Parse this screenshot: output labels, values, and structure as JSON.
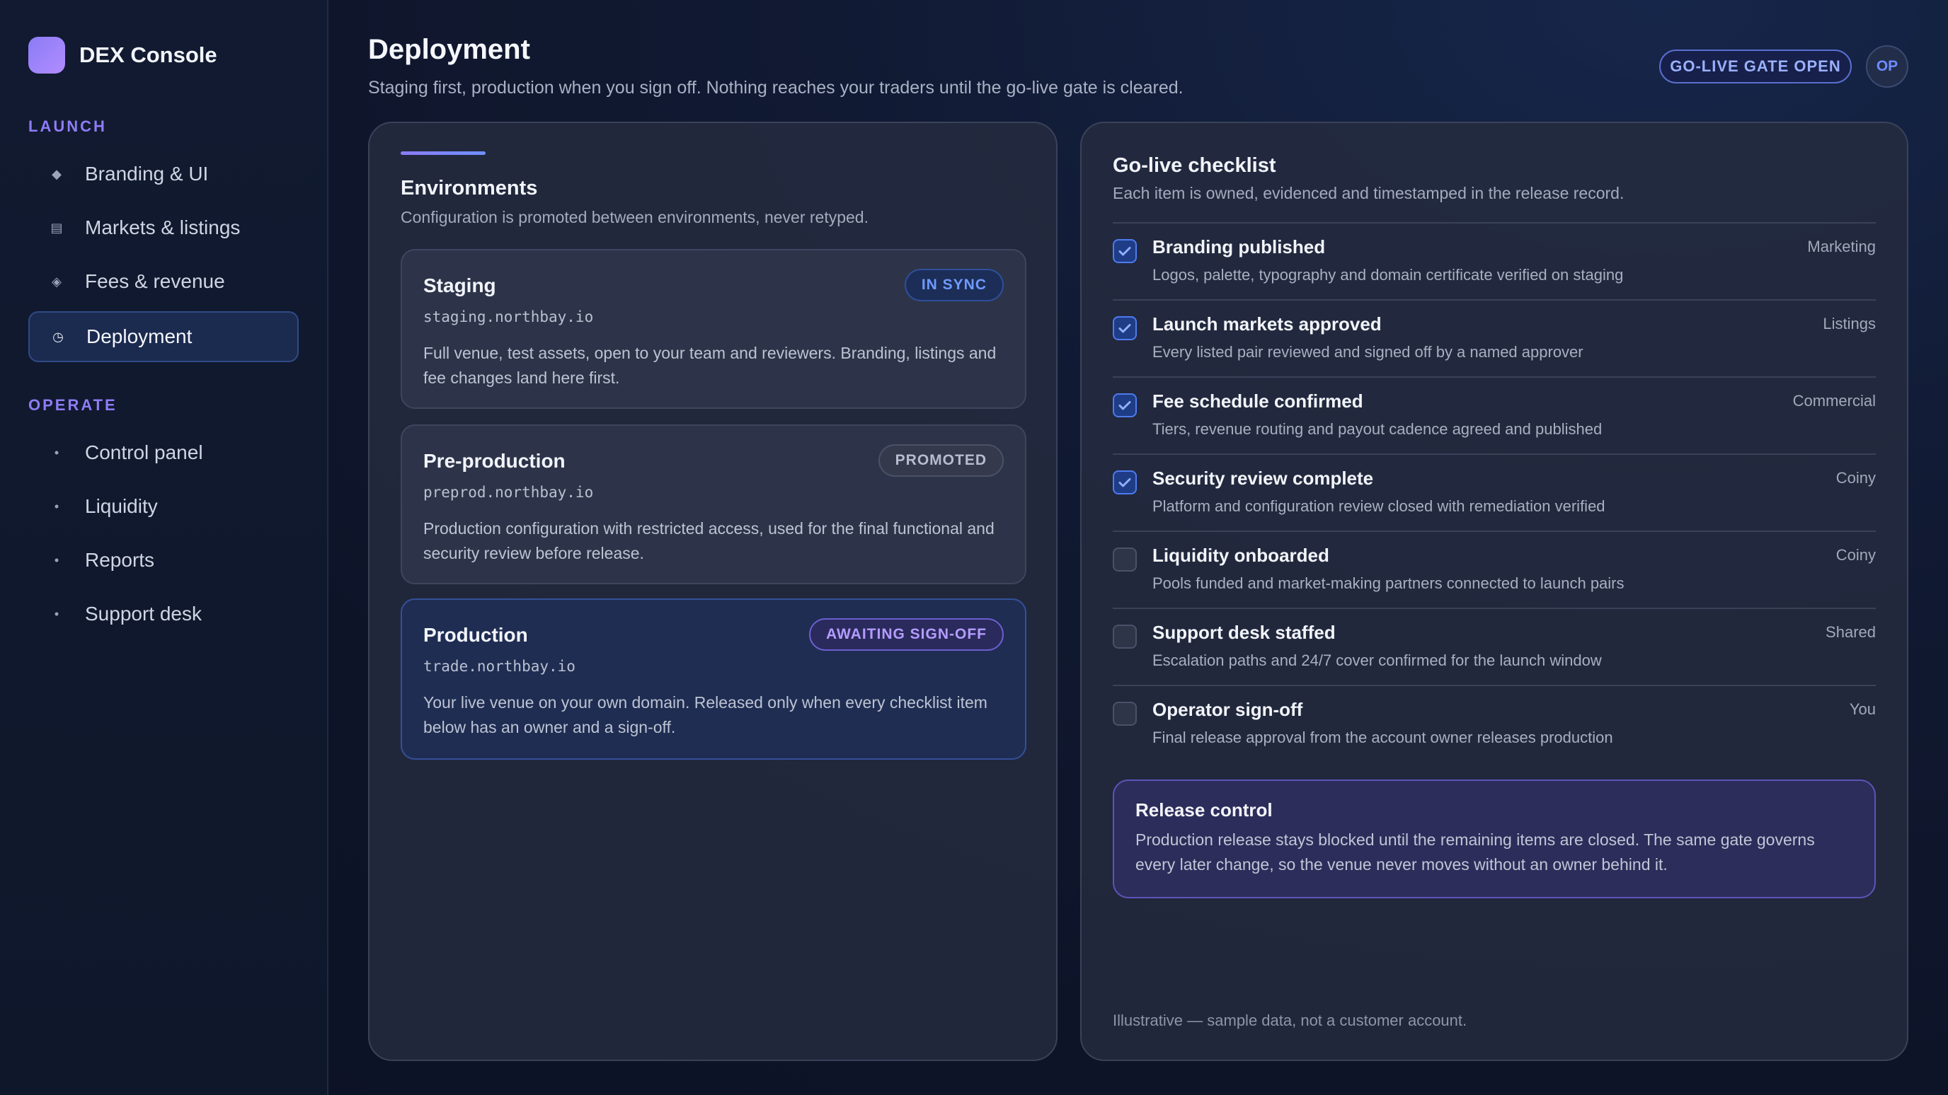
{
  "app": {
    "name": "DEX Console"
  },
  "sidebar": {
    "sections": [
      {
        "label": "LAUNCH",
        "items": [
          {
            "label": "Branding & UI",
            "icon": "diamond-icon"
          },
          {
            "label": "Markets & listings",
            "icon": "list-icon"
          },
          {
            "label": "Fees & revenue",
            "icon": "diamond-outline-icon"
          },
          {
            "label": "Deployment",
            "icon": "clock-icon",
            "active": true
          }
        ]
      },
      {
        "label": "OPERATE",
        "items": [
          {
            "label": "Control panel",
            "icon": "bullet-icon"
          },
          {
            "label": "Liquidity",
            "icon": "bullet-icon"
          },
          {
            "label": "Reports",
            "icon": "bullet-icon"
          },
          {
            "label": "Support desk",
            "icon": "bullet-icon"
          }
        ]
      }
    ]
  },
  "header": {
    "title": "Deployment",
    "subtitle": "Staging first, production when you sign off. Nothing reaches your traders until the go-live gate is cleared.",
    "gate_badge": "GO-LIVE GATE OPEN",
    "avatar": "OP"
  },
  "environments": {
    "title": "Environments",
    "subtitle": "Configuration is promoted between environments, never retyped.",
    "cards": [
      {
        "name": "Staging",
        "host": "staging.northbay.io",
        "badge": "IN SYNC",
        "description": "Full venue, test assets, open to your team and reviewers. Branding, listings and fee changes land here first."
      },
      {
        "name": "Pre-production",
        "host": "preprod.northbay.io",
        "badge": "PROMOTED",
        "description": "Production configuration with restricted access, used for the final functional and security review before release."
      },
      {
        "name": "Production",
        "host": "trade.northbay.io",
        "badge": "AWAITING SIGN-OFF",
        "description": "Your live venue on your own domain. Released only when every checklist item below has an owner and a sign-off."
      }
    ]
  },
  "checklist": {
    "title": "Go-live checklist",
    "subtitle": "Each item is owned, evidenced and timestamped in the release record.",
    "items": [
      {
        "title": "Branding published",
        "description": "Logos, palette, typography and domain certificate verified on staging",
        "owner": "Marketing",
        "checked": true
      },
      {
        "title": "Launch markets approved",
        "description": "Every listed pair reviewed and signed off by a named approver",
        "owner": "Listings",
        "checked": true
      },
      {
        "title": "Fee schedule confirmed",
        "description": "Tiers, revenue routing and payout cadence agreed and published",
        "owner": "Commercial",
        "checked": true
      },
      {
        "title": "Security review complete",
        "description": "Platform and configuration review closed with remediation verified",
        "owner": "Coiny",
        "checked": true
      },
      {
        "title": "Liquidity onboarded",
        "description": "Pools funded and market-making partners connected to launch pairs",
        "owner": "Coiny",
        "checked": false
      },
      {
        "title": "Support desk staffed",
        "description": "Escalation paths and 24/7 cover confirmed for the launch window",
        "owner": "Shared",
        "checked": false
      },
      {
        "title": "Operator sign-off",
        "description": "Final release approval from the account owner releases production",
        "owner": "You",
        "checked": false
      }
    ],
    "release": {
      "title": "Release control",
      "description": "Production release stays blocked until the remaining items are closed. The same gate governs every later change, so the venue never moves without an owner behind it."
    },
    "footnote": "Illustrative — sample data, not a customer account."
  },
  "colors": {
    "accent": "#8b7cf6",
    "checked": "#4d7cf0",
    "background": "#0e1428"
  }
}
